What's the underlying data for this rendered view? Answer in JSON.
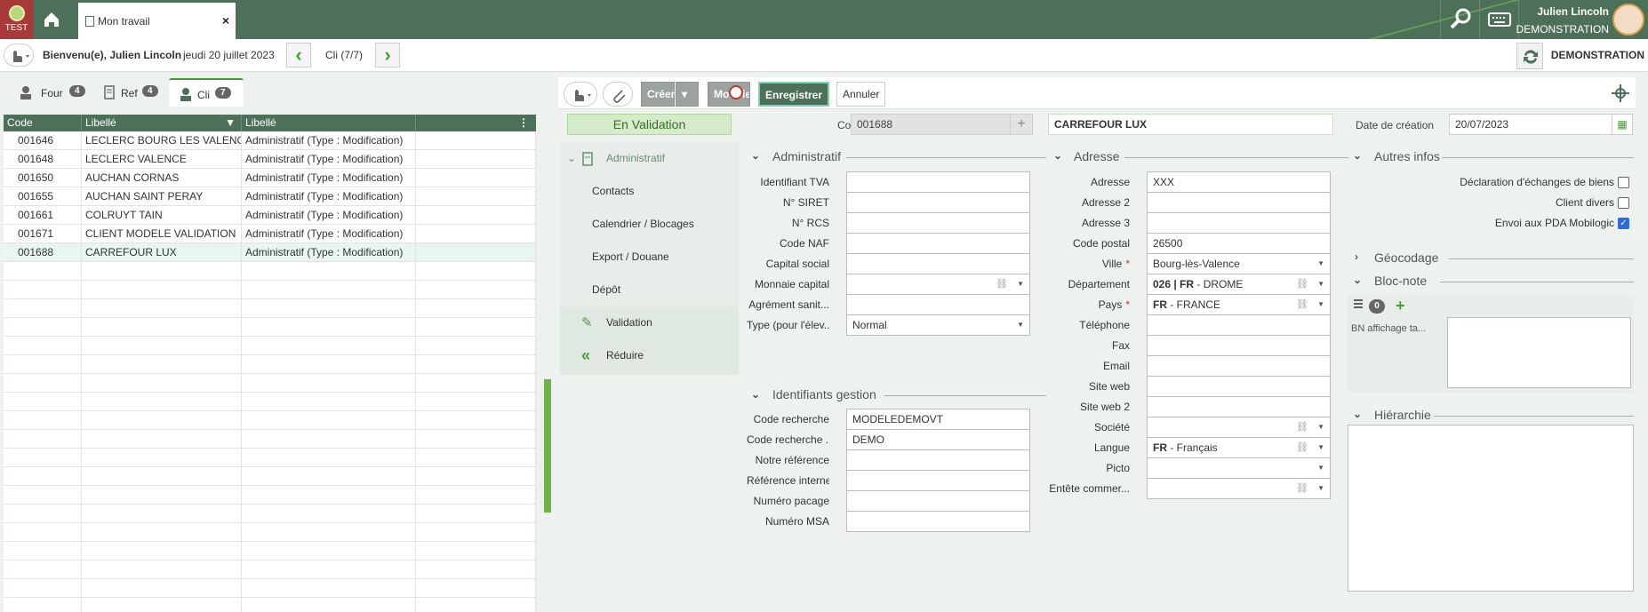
{
  "app": {
    "env_label": "TEST",
    "tab_title": "Mon travail",
    "tab_close": "×"
  },
  "user": {
    "name": "Julien Lincoln",
    "org": "DEMONSTRATION"
  },
  "subbar": {
    "welcome": "Bienvenu(e), Julien Lincoln",
    "date": "jeudi 20 juillet 2023",
    "nav_label": "Cli (7/7)",
    "right_org": "DEMONSTRATION"
  },
  "left_tabs": [
    {
      "label": "Four",
      "badge": "4"
    },
    {
      "label": "Ref",
      "badge": "4"
    },
    {
      "label": "Cli",
      "badge": "7"
    }
  ],
  "grid": {
    "headers": [
      "Code",
      "Libellé",
      "Libellé"
    ],
    "rows": [
      [
        "001646",
        "LECLERC BOURG LES VALENCE",
        "Administratif (Type : Modification)"
      ],
      [
        "001648",
        "LECLERC VALENCE",
        "Administratif (Type : Modification)"
      ],
      [
        "001650",
        "AUCHAN CORNAS",
        "Administratif (Type : Modification)"
      ],
      [
        "001655",
        "AUCHAN SAINT PERAY",
        "Administratif (Type : Modification)"
      ],
      [
        "001661",
        "COLRUYT TAIN",
        "Administratif (Type : Modification)"
      ],
      [
        "001671",
        "CLIENT MODELE VALIDATION",
        "Administratif (Type : Modification)"
      ],
      [
        "001688",
        "CARREFOUR LUX",
        "Administratif (Type : Modification)"
      ]
    ]
  },
  "toolbar": {
    "creer": "Créer",
    "modifier": "Modifier",
    "enregistrer": "Enregistrer",
    "annuler": "Annuler"
  },
  "header_form": {
    "status": "En Validation",
    "code_label": "Code",
    "code_value": "001688",
    "name_value": "CARREFOUR LUX",
    "date_label": "Date de création",
    "date_value": "20/07/2023"
  },
  "side_nav": {
    "head": "Administratif",
    "items": [
      "Contacts",
      "Calendrier / Blocages",
      "Export / Douane",
      "Dépôt"
    ],
    "validation": "Validation",
    "reduire": "Réduire"
  },
  "admin": {
    "title": "Administratif",
    "fields": [
      {
        "label": "Identifiant TVA",
        "value": ""
      },
      {
        "label": "N° SIRET",
        "value": ""
      },
      {
        "label": "N° RCS",
        "value": ""
      },
      {
        "label": "Code NAF",
        "value": ""
      },
      {
        "label": "Capital social",
        "value": ""
      },
      {
        "label": "Monnaie capital",
        "value": ""
      },
      {
        "label": "Agrément sanit...",
        "value": ""
      },
      {
        "label": "Type (pour l'élev...",
        "value": "Normal"
      }
    ]
  },
  "ident": {
    "title": "Identifiants gestion",
    "fields": [
      {
        "label": "Code recherche",
        "value": "MODELEDEMOVT"
      },
      {
        "label": "Code recherche ...",
        "value": "DEMO"
      },
      {
        "label": "Notre référence",
        "value": ""
      },
      {
        "label": "Référence interne",
        "value": ""
      },
      {
        "label": "Numéro pacage",
        "value": ""
      },
      {
        "label": "Numéro MSA",
        "value": ""
      }
    ]
  },
  "adresse": {
    "title": "Adresse",
    "fields": [
      {
        "label": "Adresse",
        "value": "XXX"
      },
      {
        "label": "Adresse 2",
        "value": ""
      },
      {
        "label": "Adresse 3",
        "value": ""
      },
      {
        "label": "Code postal",
        "value": "26500"
      },
      {
        "label": "Ville",
        "value": "Bourg-lès-Valence"
      },
      {
        "label": "Département",
        "value_bold": "026 | FR",
        "value": " - DROME"
      },
      {
        "label": "Pays",
        "value_bold": "FR",
        "value": " - FRANCE"
      },
      {
        "label": "Téléphone",
        "value": ""
      },
      {
        "label": "Fax",
        "value": ""
      },
      {
        "label": "Email",
        "value": ""
      },
      {
        "label": "Site web",
        "value": ""
      },
      {
        "label": "Site web 2",
        "value": ""
      },
      {
        "label": "Société",
        "value": ""
      },
      {
        "label": "Langue",
        "value_bold": "FR",
        "value": " - Français"
      },
      {
        "label": "Picto",
        "value": ""
      },
      {
        "label": "Entête commer...",
        "value": ""
      }
    ],
    "required_mark": "*"
  },
  "autres": {
    "title": "Autres infos",
    "checks": [
      {
        "label": "Déclaration d'échanges de biens",
        "checked": false
      },
      {
        "label": "Client divers",
        "checked": false
      },
      {
        "label": "Envoi aux PDA Mobilogic",
        "checked": true
      }
    ],
    "geocodage": "Géocodage",
    "blocnote": "Bloc-note",
    "bn_count": "0",
    "bn_label": "BN affichage ta...",
    "hierarchie": "Hiérarchie"
  }
}
